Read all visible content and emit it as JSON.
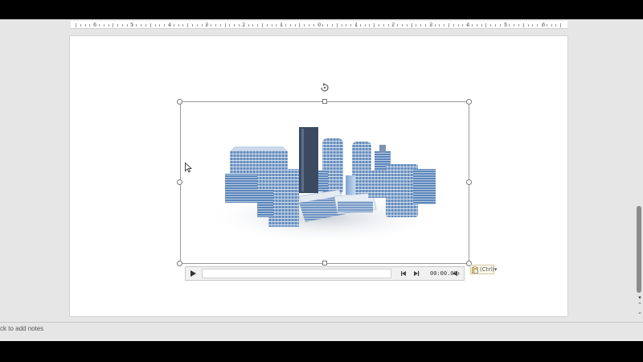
{
  "ruler": {
    "labels": [
      "6",
      "5",
      "4",
      "3",
      "2",
      "1",
      "0",
      "1",
      "2",
      "3",
      "4",
      "5",
      "6"
    ]
  },
  "media_controls": {
    "time": "00:00.00"
  },
  "paste_options": {
    "label": "(Ctrl)",
    "arrow": "▾"
  },
  "notes": {
    "placeholder": "ck to add notes"
  },
  "icons": {
    "play": "play-icon",
    "rewind": "rewind-icon",
    "forward": "forward-icon",
    "volume": "volume-icon",
    "rotate": "rotate-icon",
    "clipboard": "clipboard-icon",
    "cursor": "mouse-cursor-icon"
  },
  "colors": {
    "app_background": "#e6e6e6",
    "slide_background": "#ffffff",
    "building_blue": "#6e98c8",
    "building_dark": "#3c4a60",
    "scroll_thumb": "#8b8b8b"
  }
}
